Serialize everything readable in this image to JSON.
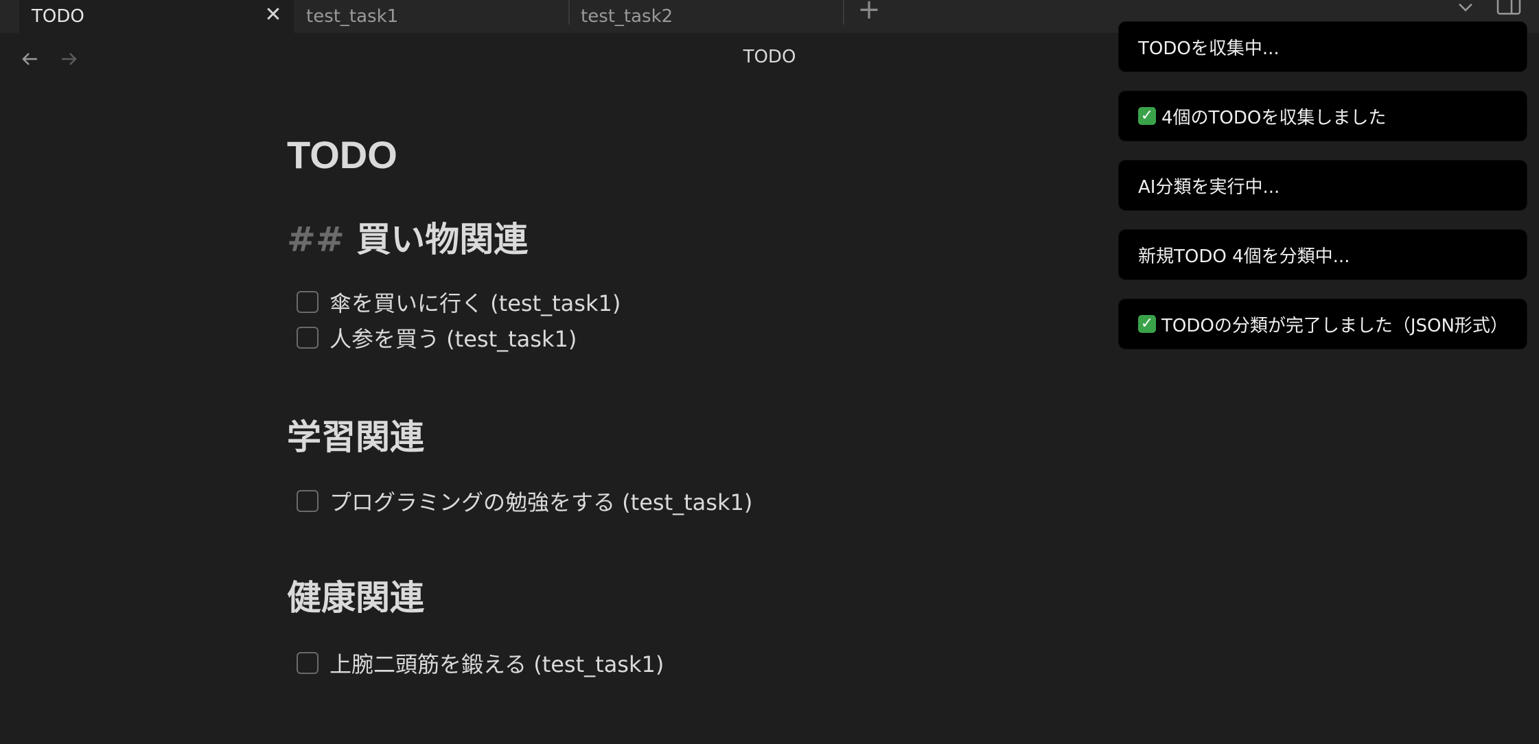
{
  "tabs": {
    "active_label": "TODO",
    "tab1_label": "test_task1",
    "tab2_label": "test_task2",
    "close_symbol": "✕",
    "new_tab_symbol": "+"
  },
  "nav": {
    "title": "TODO"
  },
  "note": {
    "title": "TODO",
    "sections": [
      {
        "hash": "##",
        "heading": "買い物関連",
        "tasks": [
          "傘を買いに行く (test_task1)",
          "人参を買う (test_task1)"
        ]
      },
      {
        "heading": "学習関連",
        "tasks": [
          "プログラミングの勉強をする (test_task1)"
        ]
      },
      {
        "heading": "健康関連",
        "tasks": [
          "上腕二頭筋を鍛える (test_task1)"
        ]
      }
    ]
  },
  "notices": [
    {
      "text": "TODOを収集中..."
    },
    {
      "text": "4個のTODOを収集しました",
      "check": "✓"
    },
    {
      "text": "AI分類を実行中..."
    },
    {
      "text": "新規TODO 4個を分類中..."
    },
    {
      "text": "TODOの分類が完了しました（JSON形式）",
      "check": "✓"
    }
  ],
  "colors": {
    "background": "#1e1e1e",
    "tabbar": "#262626",
    "notice_bg": "#000000",
    "check_green": "#3aa34a"
  }
}
